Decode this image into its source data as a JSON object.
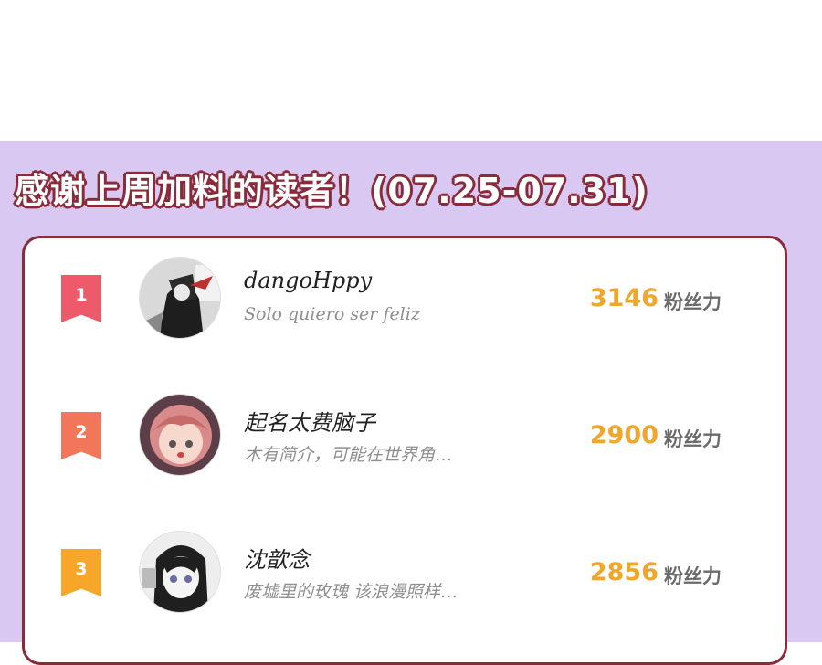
{
  "title": "感谢上周加料的读者！(07.25-07.31)",
  "unit_label": "粉丝力",
  "colors": {
    "background_panel": "#d8c8f2",
    "title_outline": "#8a2b3a",
    "card_border": "#8a2b3a",
    "score": "#f0a62a",
    "rank_1": "#ef5a6a",
    "rank_2": "#f2775a",
    "rank_3": "#f6a72a"
  },
  "readers": [
    {
      "rank": "1",
      "name": "dangoHppy",
      "signature": "Solo quiero ser feliz",
      "score": "3146",
      "avatar_icon": "anime-avatar-icon"
    },
    {
      "rank": "2",
      "name": "起名太费脑子",
      "signature": "木有简介，可能在世界角…",
      "score": "2900",
      "avatar_icon": "anime-avatar-icon"
    },
    {
      "rank": "3",
      "name": "沈歆念",
      "signature": "废墟里的玫瑰 该浪漫照样…",
      "score": "2856",
      "avatar_icon": "anime-avatar-icon"
    }
  ]
}
